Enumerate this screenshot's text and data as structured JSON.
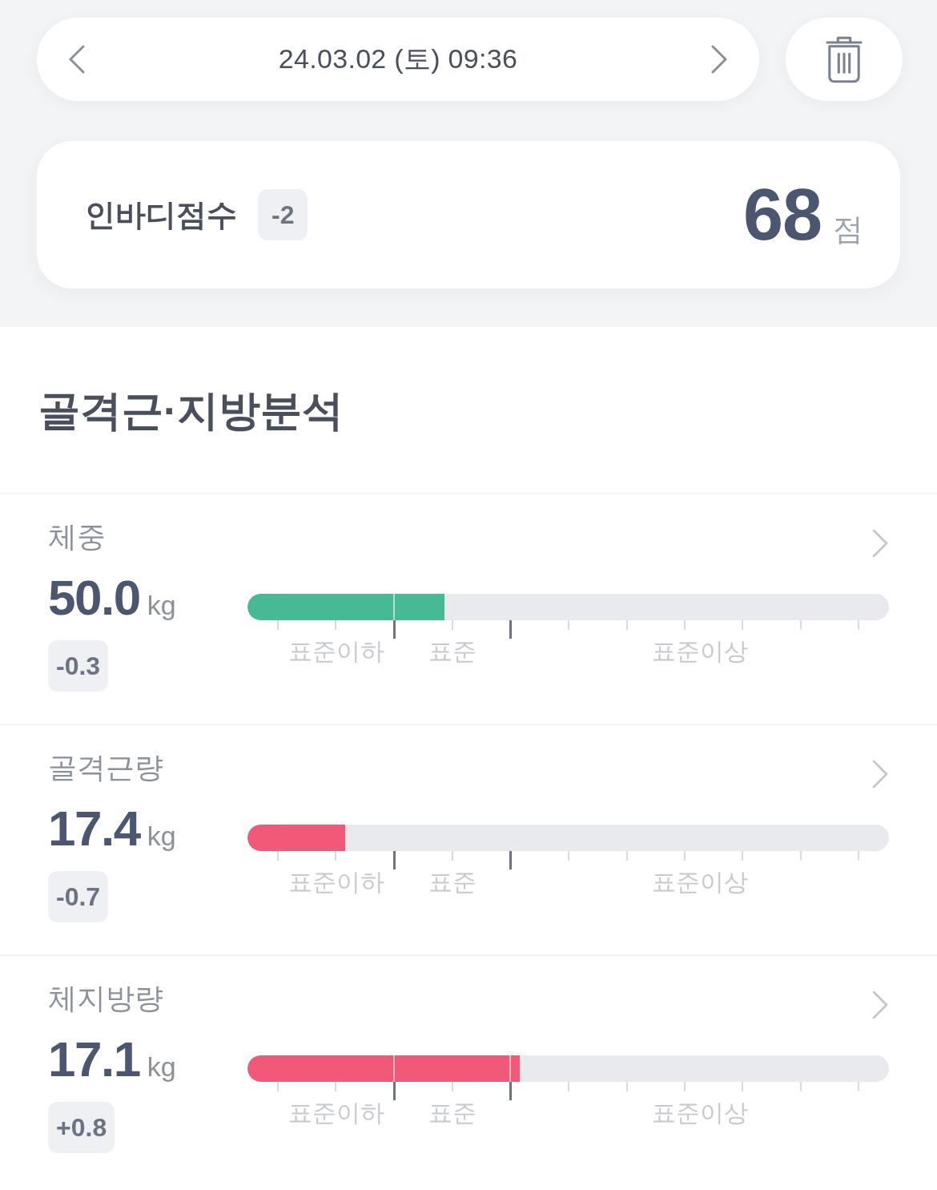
{
  "date_nav": {
    "date": "24.03.02 (토) 09:36"
  },
  "score_card": {
    "label": "인바디점수",
    "change": "-2",
    "score": "68",
    "unit": "점"
  },
  "section": {
    "title": "골격근·지방분석"
  },
  "metrics": [
    {
      "name": "체중",
      "value": "50.0",
      "unit": "kg",
      "change": "-0.3",
      "level": 0.307,
      "color": "#47b995",
      "scale_labels": [
        "표준이하",
        "표준",
        "표준이상"
      ]
    },
    {
      "name": "골격근량",
      "value": "17.4",
      "unit": "kg",
      "change": "-0.7",
      "level": 0.152,
      "color": "#f05a78",
      "scale_labels": [
        "표준이하",
        "표준",
        "표준이상"
      ]
    },
    {
      "name": "체지방량",
      "value": "17.1",
      "unit": "kg",
      "change": "+0.8",
      "level": 0.424,
      "color": "#f05a78",
      "scale_labels": [
        "표준이하",
        "표준",
        "표준이상"
      ]
    }
  ]
}
